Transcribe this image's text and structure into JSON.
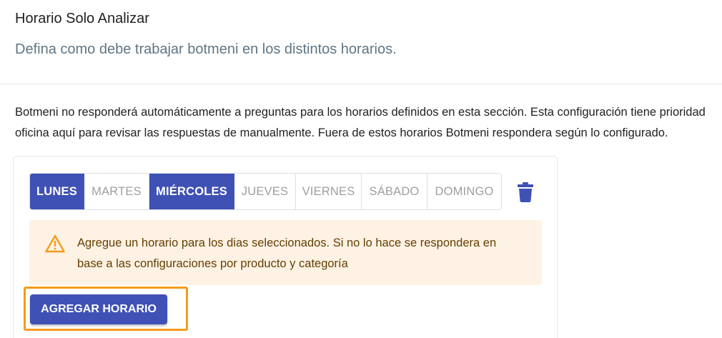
{
  "header": {
    "title": "Horario Solo Analizar",
    "subtitle": "Defina como debe trabajar botmeni en los distintos horarios."
  },
  "description": {
    "line1": "Botmeni no responderá automáticamente a preguntas para los horarios definidos en esta sección. Esta configuración tiene prioridad",
    "line2": "oficina aquí para revisar las respuestas de manualmente. Fuera de estos horarios Botmeni respondera según lo configurado."
  },
  "days": [
    {
      "label": "LUNES",
      "active": true
    },
    {
      "label": "MARTES",
      "active": false
    },
    {
      "label": "MIÉRCOLES",
      "active": true
    },
    {
      "label": "JUEVES",
      "active": false
    },
    {
      "label": "VIERNES",
      "active": false
    },
    {
      "label": "SÁBADO",
      "active": false
    },
    {
      "label": "DOMINGO",
      "active": false
    }
  ],
  "delete_icon": "trash-icon",
  "alert": {
    "icon": "warning-icon",
    "text": "Agregue un horario para los dias seleccionados. Si no lo hace se respondera en base a las configuraciones por producto y categoría"
  },
  "add_button_label": "AGREGAR HORARIO",
  "colors": {
    "primary": "#3f51b5",
    "alert_bg": "#fdf2e4",
    "alert_text": "#663d00",
    "warning": "#ff9800",
    "highlight": "#f59a1b"
  }
}
